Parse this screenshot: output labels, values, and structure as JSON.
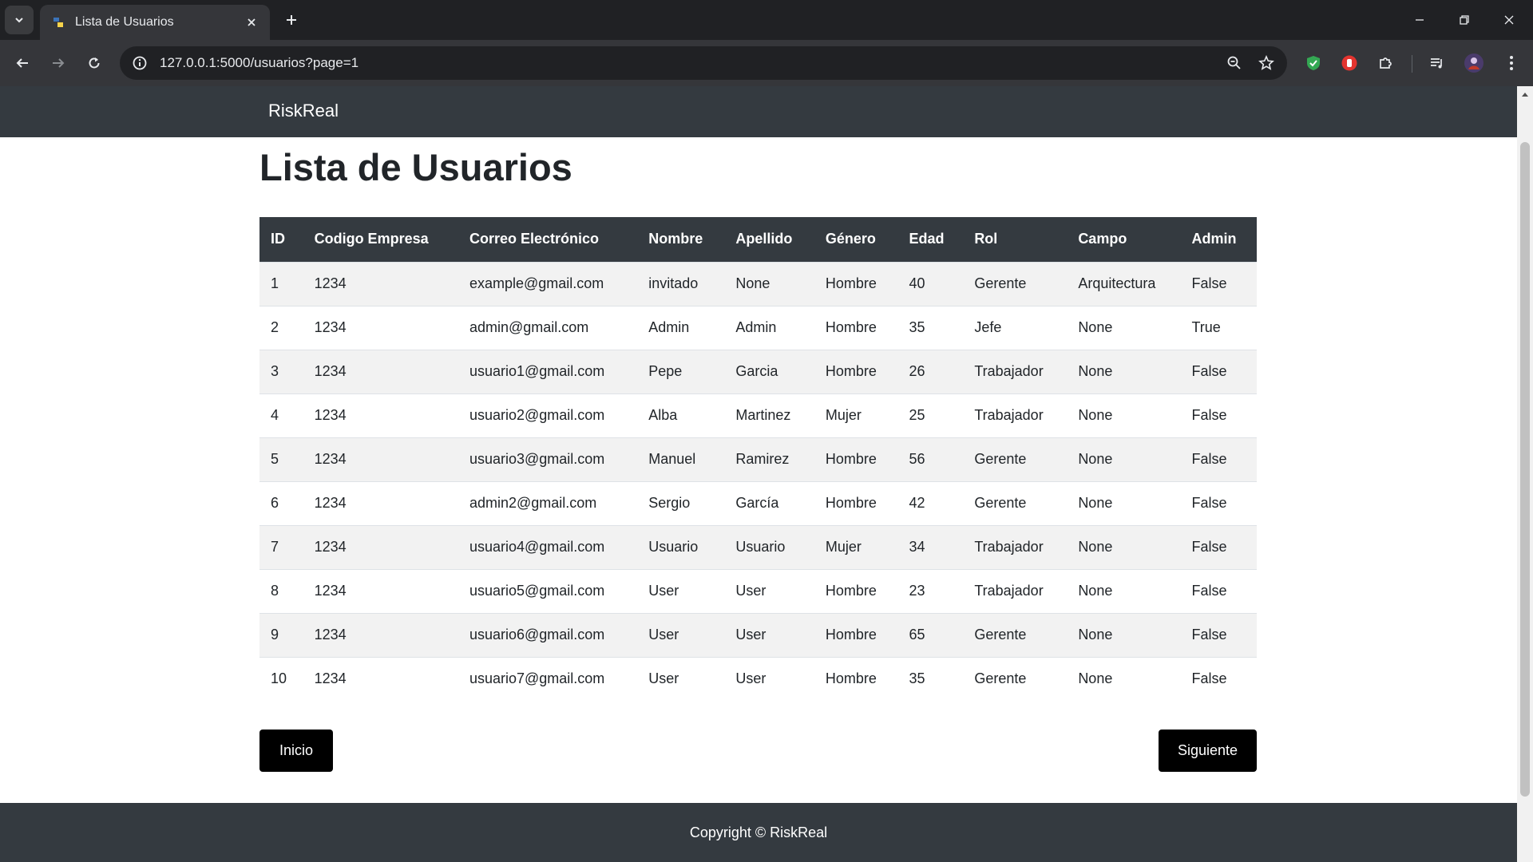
{
  "browser": {
    "tab_title": "Lista de Usuarios",
    "url": "127.0.0.1:5000/usuarios?page=1"
  },
  "icons": {
    "tab_search": "chevron-down-icon",
    "favicon": "python-icon",
    "tab_close": "close-icon",
    "new_tab": "plus-icon",
    "back": "arrow-left-icon",
    "forward": "arrow-right-icon",
    "reload": "reload-icon",
    "site_info": "info-icon",
    "zoom": "zoom-icon",
    "bookmark": "star-icon",
    "extensions": [
      "shield-icon",
      "stop-hand-icon",
      "puzzle-icon"
    ],
    "media": "media-queue-icon",
    "profile": "avatar",
    "menu": "kebab-menu-icon"
  },
  "navbar": {
    "brand": "RiskReal"
  },
  "page": {
    "title": "Lista de Usuarios"
  },
  "table": {
    "headers": [
      "ID",
      "Codigo Empresa",
      "Correo Electrónico",
      "Nombre",
      "Apellido",
      "Género",
      "Edad",
      "Rol",
      "Campo",
      "Admin"
    ],
    "rows": [
      [
        "1",
        "1234",
        "example@gmail.com",
        "invitado",
        "None",
        "Hombre",
        "40",
        "Gerente",
        "Arquitectura",
        "False"
      ],
      [
        "2",
        "1234",
        "admin@gmail.com",
        "Admin",
        "Admin",
        "Hombre",
        "35",
        "Jefe",
        "None",
        "True"
      ],
      [
        "3",
        "1234",
        "usuario1@gmail.com",
        "Pepe",
        "Garcia",
        "Hombre",
        "26",
        "Trabajador",
        "None",
        "False"
      ],
      [
        "4",
        "1234",
        "usuario2@gmail.com",
        "Alba",
        "Martinez",
        "Mujer",
        "25",
        "Trabajador",
        "None",
        "False"
      ],
      [
        "5",
        "1234",
        "usuario3@gmail.com",
        "Manuel",
        "Ramirez",
        "Hombre",
        "56",
        "Gerente",
        "None",
        "False"
      ],
      [
        "6",
        "1234",
        "admin2@gmail.com",
        "Sergio",
        "García",
        "Hombre",
        "42",
        "Gerente",
        "None",
        "False"
      ],
      [
        "7",
        "1234",
        "usuario4@gmail.com",
        "Usuario",
        "Usuario",
        "Mujer",
        "34",
        "Trabajador",
        "None",
        "False"
      ],
      [
        "8",
        "1234",
        "usuario5@gmail.com",
        "User",
        "User",
        "Hombre",
        "23",
        "Trabajador",
        "None",
        "False"
      ],
      [
        "9",
        "1234",
        "usuario6@gmail.com",
        "User",
        "User",
        "Hombre",
        "65",
        "Gerente",
        "None",
        "False"
      ],
      [
        "10",
        "1234",
        "usuario7@gmail.com",
        "User",
        "User",
        "Hombre",
        "35",
        "Gerente",
        "None",
        "False"
      ]
    ]
  },
  "pagination": {
    "start_label": "Inicio",
    "next_label": "Siguiente"
  },
  "footer": {
    "text": "Copyright © RiskReal"
  },
  "colors": {
    "navbar_bg": "#343a40",
    "button_bg": "#000000",
    "row_stripe": "#f2f2f2",
    "chrome_dark": "#202124"
  }
}
